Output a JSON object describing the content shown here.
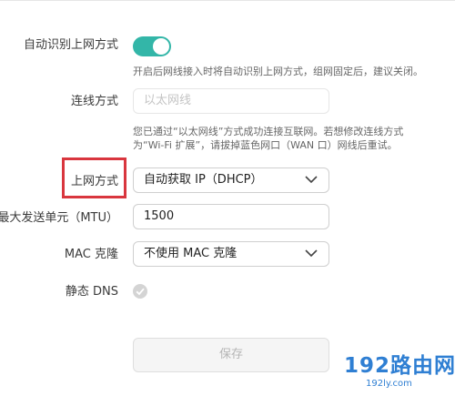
{
  "settings": {
    "auto_detect": {
      "label": "自动识别上网方式",
      "enabled": true,
      "hint": "开启后网线接入时将自动识别上网方式，组网固定后，建议关闭。"
    },
    "connection_type": {
      "label": "连线方式",
      "value": "以太网线",
      "hint_line1": "您已通过“以太网线”方式成功连接互联网。若想修改连线方式",
      "hint_line2": "为“Wi-Fi 扩展”，请拔掉蓝色网口（WAN 口）网线后重试。"
    },
    "internet_mode": {
      "label": "上网方式",
      "value": "自动获取 IP（DHCP）"
    },
    "mtu": {
      "label": "最大发送单元（MTU）",
      "value": "1500"
    },
    "mac_clone": {
      "label": "MAC 克隆",
      "value": "不使用 MAC 克隆"
    },
    "static_dns": {
      "label": "静态 DNS",
      "checked": false
    },
    "save_label": "保存"
  },
  "watermark": {
    "main": "192路由网",
    "sub": "192ly.com"
  },
  "colors": {
    "toggle_on": "#33b6a8",
    "highlight": "#d9363e",
    "watermark": "#2f7fd3"
  },
  "icons": {
    "dropdown": "chevron-down-icon",
    "check": "check-circle-icon"
  }
}
